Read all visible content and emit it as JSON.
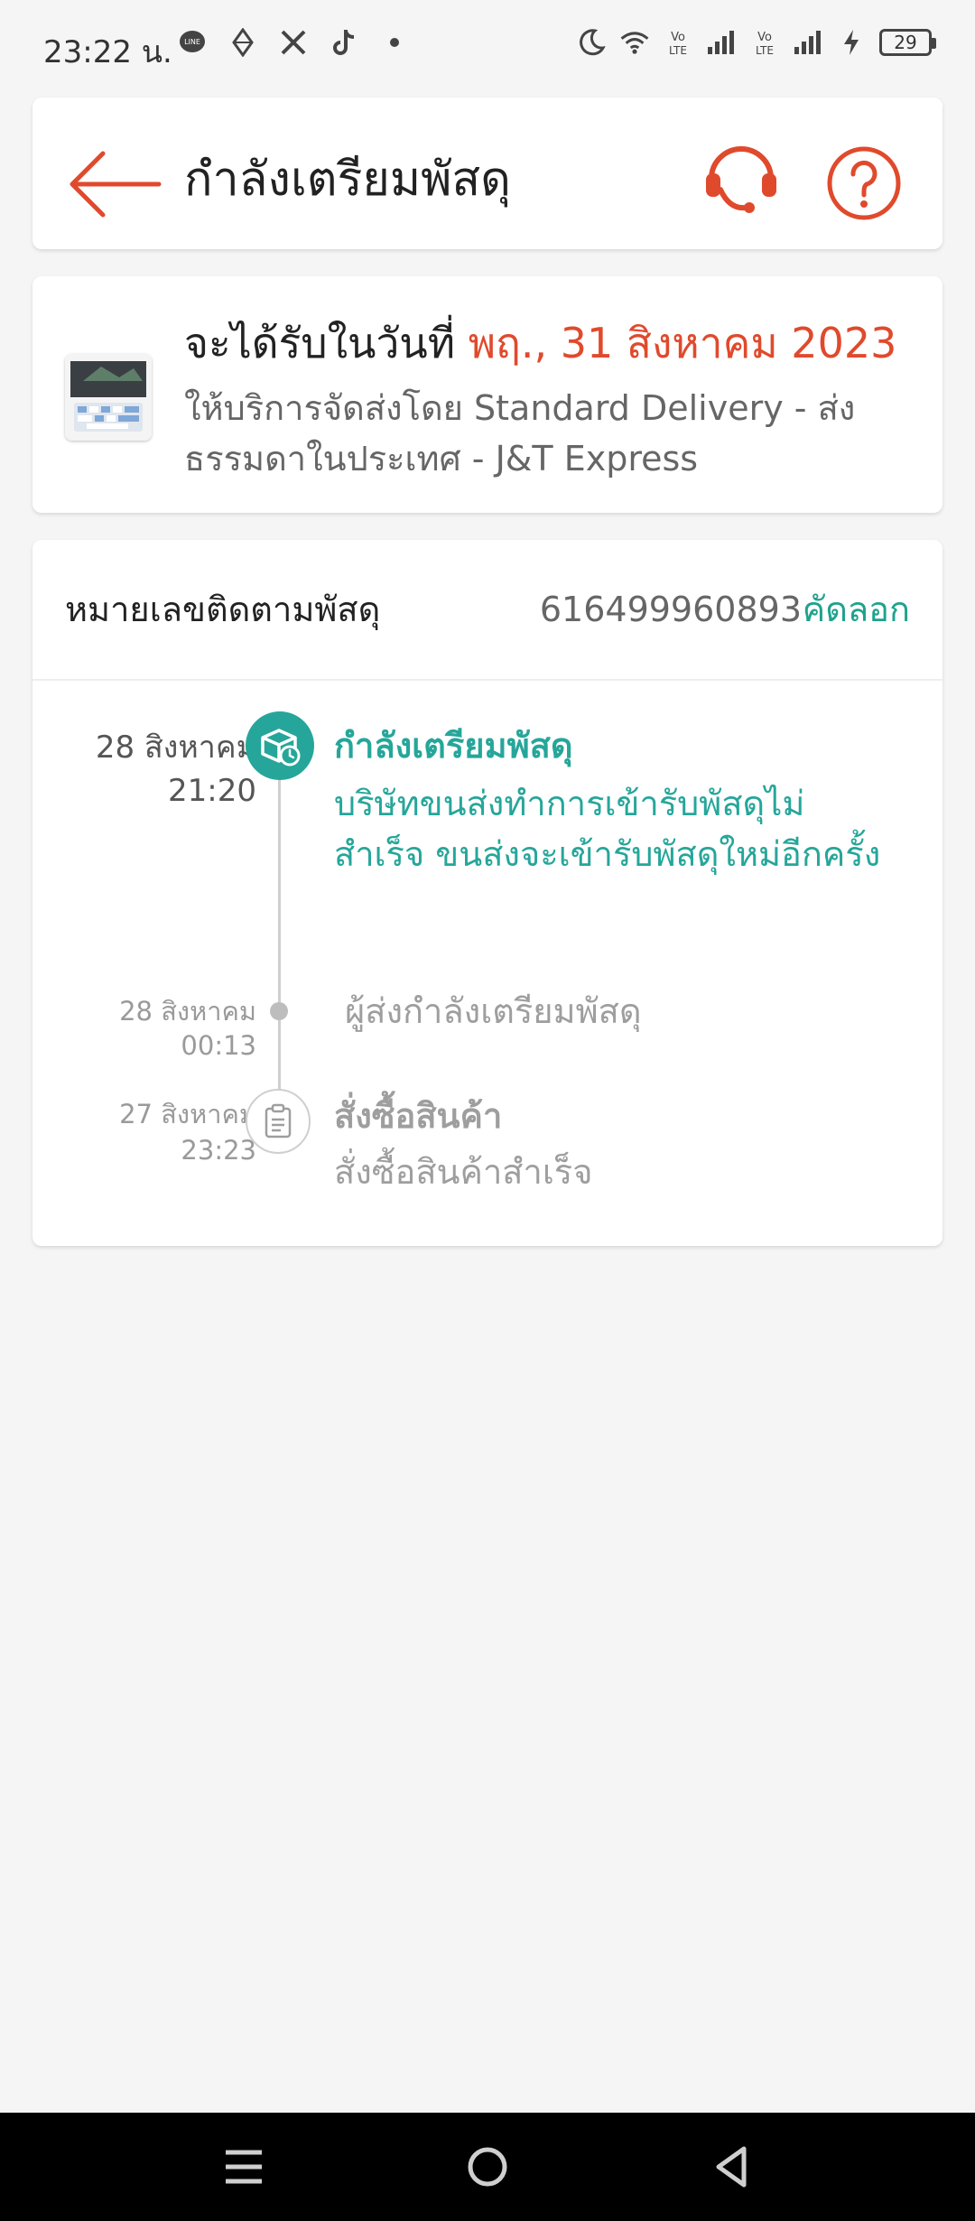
{
  "status_bar": {
    "time": "23:22 น.",
    "battery": "29",
    "left_icons": [
      "line-icon",
      "diamond-icon",
      "x-icon",
      "tiktok-icon",
      "dot-icon"
    ],
    "right_icons": [
      "moon-icon",
      "wifi-icon",
      "volte-icon",
      "signal-icon",
      "volte-icon",
      "signal-icon",
      "charging-icon"
    ]
  },
  "header": {
    "title": "กำลังเตรียมพัสดุ",
    "accent_color": "#e04a2c"
  },
  "delivery": {
    "eta_prefix": "จะได้รับในวันที่ ",
    "eta_date": "พฤ., 31 สิงหาคม 2023",
    "service": "ให้บริการจัดส่งโดย Standard Delivery - ส่งธรรมดาในประเทศ - J&T Express"
  },
  "tracking": {
    "label": "หมายเลขติดตามพัสดุ",
    "number": "616499960893",
    "copy_label": "คัดลอก",
    "events": [
      {
        "date": "28 สิงหาคม",
        "time": "21:20",
        "title": "กำลังเตรียมพัสดุ",
        "description": "บริษัทขนส่งทำการเข้ารับพัสดุไม่สำเร็จ ขนส่งจะเข้ารับพัสดุใหม่อีกครั้ง"
      },
      {
        "date": "28 สิงหาคม",
        "time": "00:13",
        "title": "ผู้ส่งกำลังเตรียมพัสดุ"
      },
      {
        "date": "27 สิงหาคม",
        "time": "23:23",
        "title": "สั่งซื้อสินค้า",
        "description": "สั่งซื้อสินค้าสำเร็จ"
      }
    ],
    "active_color": "#26a69a"
  },
  "nav": {
    "buttons": [
      "menu-icon",
      "home-icon",
      "back-icon"
    ]
  }
}
